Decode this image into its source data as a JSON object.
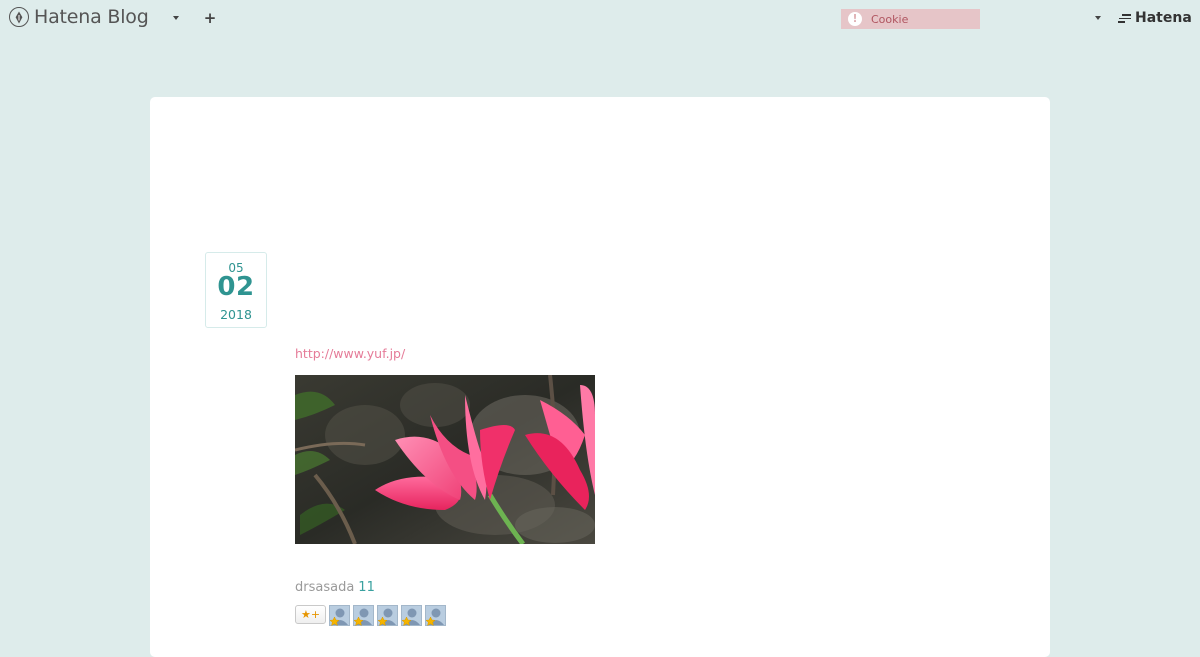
{
  "header": {
    "brand": "Hatena Blog",
    "plus_label": "+",
    "cookie_label": "Cookie",
    "cookie_alert": "!",
    "hatena_label": "Hatena"
  },
  "entry": {
    "date": {
      "month": "05",
      "day": "02",
      "year": "2018"
    },
    "link": "http://www.yuf.jp/",
    "author": "drsasada",
    "count": "11",
    "add_star_label": "★+",
    "star_users": 5
  },
  "colors": {
    "background": "#deeceb",
    "accent_teal": "#2f9491",
    "link_pink": "#e57b98",
    "cookie_bg": "#e6c5c8"
  }
}
